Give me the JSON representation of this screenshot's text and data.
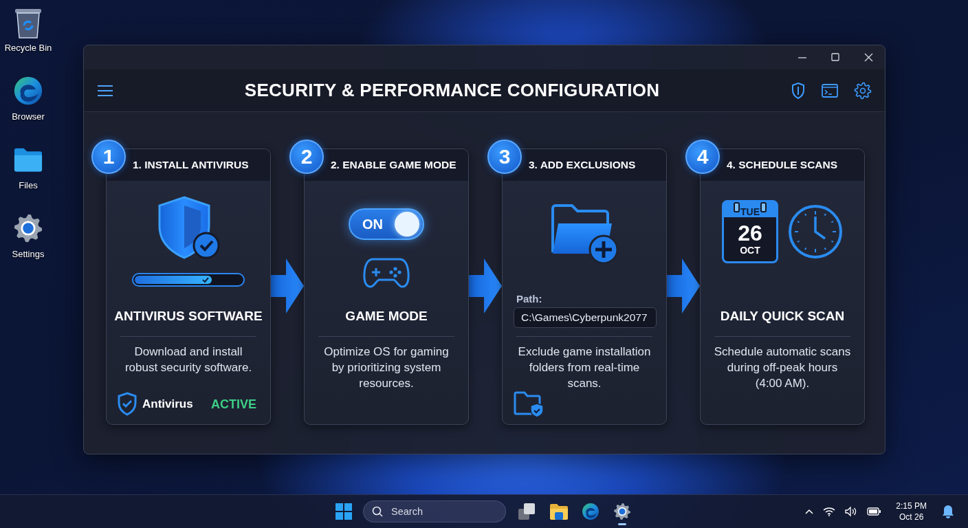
{
  "desktop_icons": [
    {
      "kind": "recycle",
      "label": "Recycle Bin"
    },
    {
      "kind": "browser",
      "label": "Browser"
    },
    {
      "kind": "files",
      "label": "Files"
    },
    {
      "kind": "settings",
      "label": "Settings"
    }
  ],
  "window": {
    "title": "SECURITY & PERFORMANCE CONFIGURATION"
  },
  "steps": [
    {
      "kind": "antivirus",
      "number": "1",
      "heading": "1. INSTALL ANTIVIRUS",
      "title": "ANTIVIRUS SOFTWARE",
      "description": "Download and install robust security software.",
      "progress": {
        "level": 0.72
      },
      "footer": {
        "label": "Antivirus",
        "status": "ACTIVE"
      }
    },
    {
      "kind": "toggle",
      "number": "2",
      "heading": "2. ENABLE GAME MODE",
      "title": "GAME MODE",
      "description": "Optimize OS for gaming by prioritizing system resources.",
      "toggle": {
        "label": "ON",
        "on": true
      }
    },
    {
      "kind": "path",
      "number": "3",
      "heading": "3. ADD EXCLUSIONS",
      "path_label": "Path:",
      "path_value": "C:\\Games\\Cyberpunk2077",
      "description": "Exclude game installation folders from real-time scans."
    },
    {
      "kind": "schedule",
      "number": "4",
      "heading": "4. SCHEDULE SCANS",
      "title": "DAILY QUICK SCAN",
      "description": "Schedule automatic scans during off-peak hours (4:00 AM).",
      "calendar": {
        "day": "TUE",
        "date": "26",
        "month": "OCT"
      }
    }
  ],
  "taskbar": {
    "search": {
      "placeholder": "Search"
    },
    "apps": [
      {
        "kind": "taskview",
        "running": false
      },
      {
        "kind": "files",
        "running": false
      },
      {
        "kind": "browser",
        "running": false
      },
      {
        "kind": "settings",
        "running": true
      }
    ],
    "clock": {
      "time": "2:15 PM",
      "date": "Oct 26"
    }
  }
}
